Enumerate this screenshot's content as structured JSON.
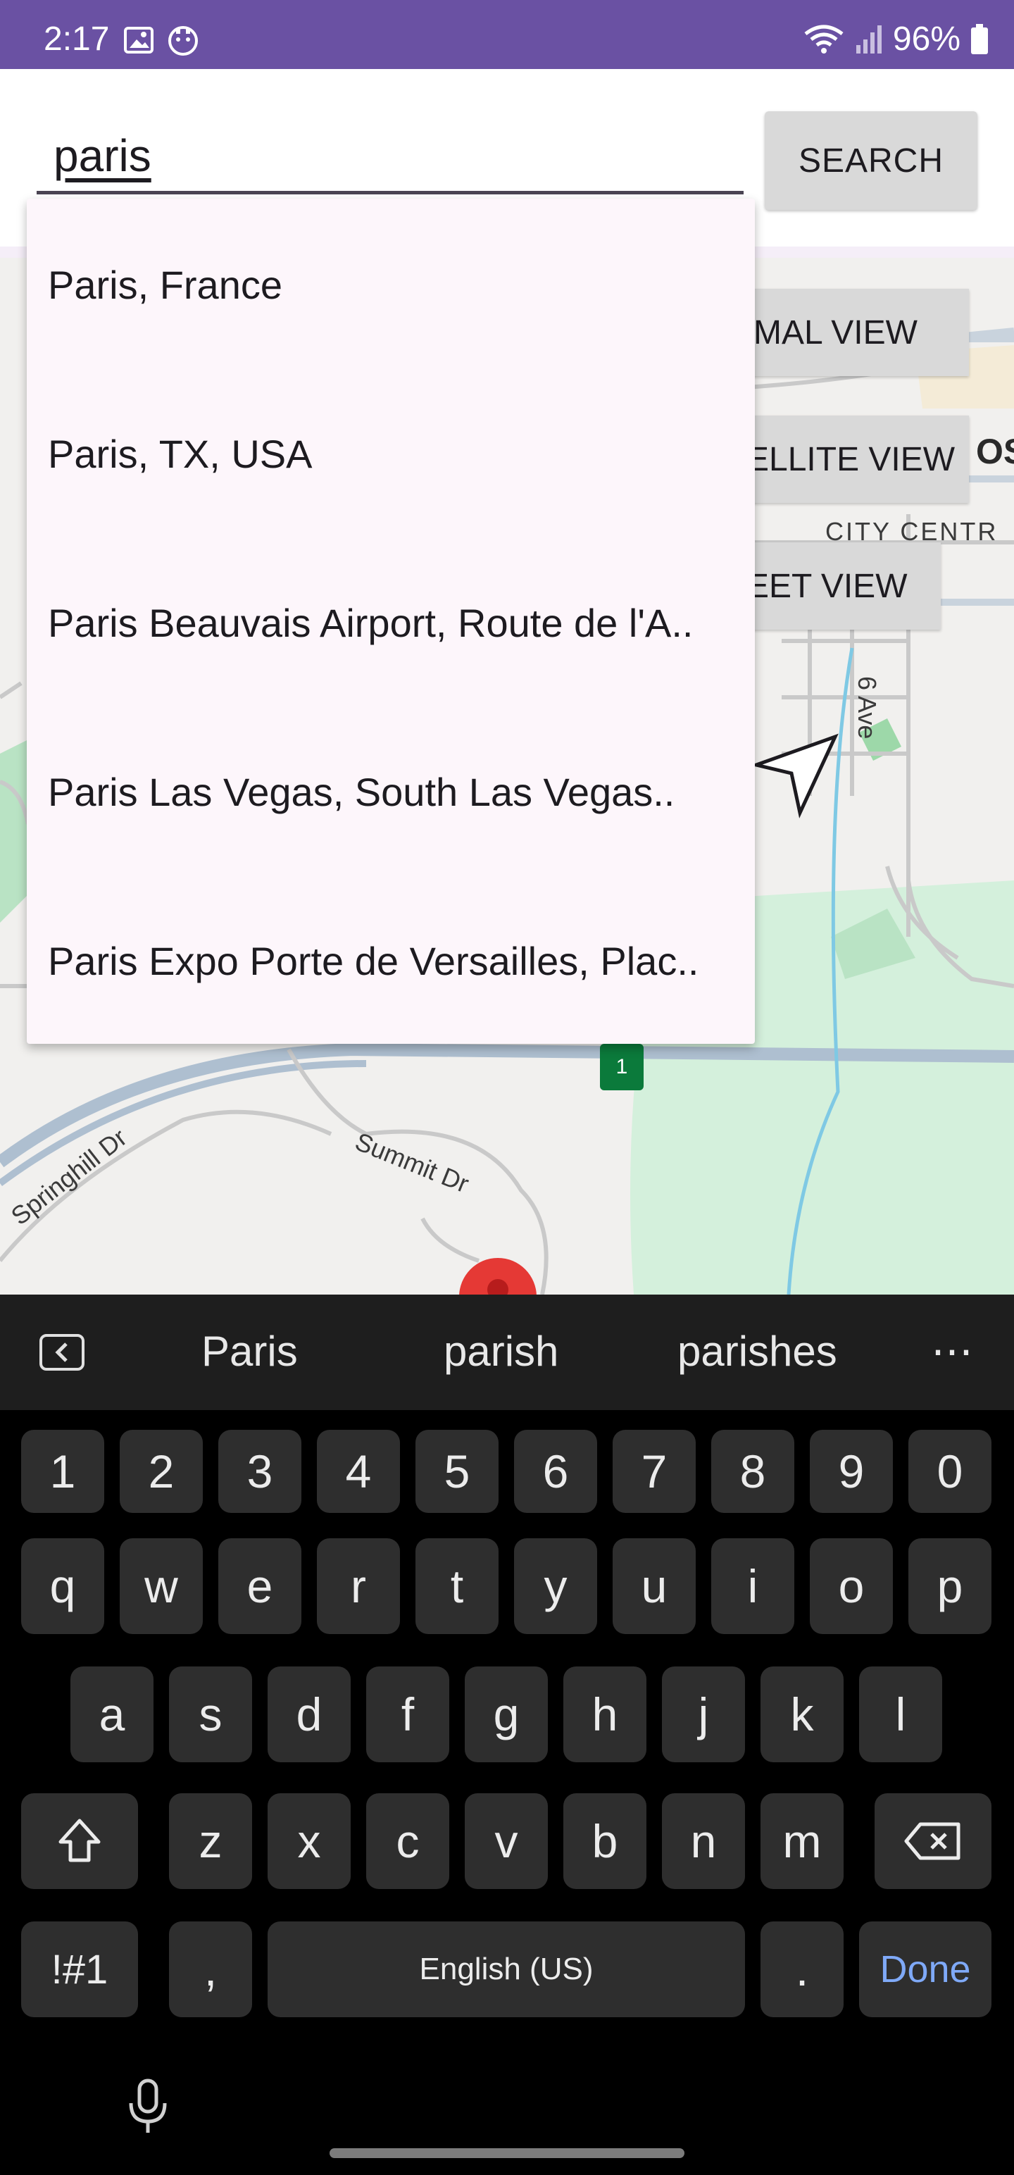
{
  "status_bar": {
    "time": "2:17",
    "battery": "96%",
    "icons": [
      "image-icon",
      "notification-face-icon",
      "wifi-icon",
      "signal-icon",
      "battery-icon"
    ]
  },
  "search": {
    "value": "paris",
    "button_label": "SEARCH"
  },
  "suggestions": [
    "Paris, France",
    "Paris, TX, USA",
    "Paris Beauvais Airport, Route de l'A..",
    "Paris Las Vegas, South Las Vegas..",
    "Paris Expo Porte de Versailles, Plac.."
  ],
  "map": {
    "buttons": {
      "normal": "MAL VIEW",
      "satellite": "ELLITE VIEW",
      "street": "EET VIEW"
    },
    "labels": {
      "city_centre": "CITY CENTR",
      "partial": "OS",
      "six_ave": "6 Ave",
      "springhill": "Springhill Dr",
      "summit": "Summit Dr",
      "route_badge": "1"
    }
  },
  "keyboard": {
    "suggestions": [
      "Paris",
      "parish",
      "parishes"
    ],
    "more": "⋯",
    "rows": {
      "numbers": [
        "1",
        "2",
        "3",
        "4",
        "5",
        "6",
        "7",
        "8",
        "9",
        "0"
      ],
      "row1": [
        "q",
        "w",
        "e",
        "r",
        "t",
        "y",
        "u",
        "i",
        "o",
        "p"
      ],
      "row2": [
        "a",
        "s",
        "d",
        "f",
        "g",
        "h",
        "j",
        "k",
        "l"
      ],
      "row3": [
        "z",
        "x",
        "c",
        "v",
        "b",
        "n",
        "m"
      ]
    },
    "symbols_label": "!#1",
    "comma": ",",
    "space_label": "English (US)",
    "period": ".",
    "done_label": "Done"
  },
  "colors": {
    "status_bar": "#6a51a3",
    "keyboard_bg": "#000000",
    "key_bg": "#2e2e2e",
    "done_accent": "#7fa9f7",
    "dropdown_bg": "#fdf6fb"
  }
}
